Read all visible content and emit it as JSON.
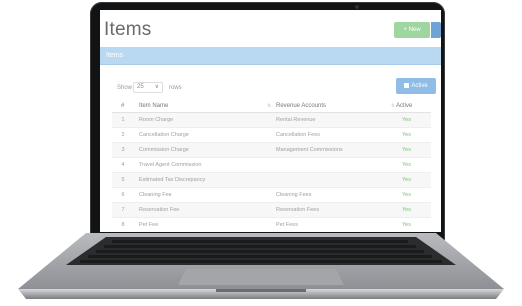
{
  "app": {
    "title": "Items",
    "new_button": "+ New",
    "panel_title": "Items"
  },
  "controls": {
    "show_label": "Show",
    "page_size": "25",
    "rows_label": "rows",
    "active_button": "Active"
  },
  "table": {
    "headers": {
      "num": "#",
      "name": "Item Name",
      "account": "Revenue Accounts",
      "active": "Active"
    },
    "rows": [
      {
        "num": "1",
        "name": "Room Charge",
        "account": "Rental Revenue",
        "active": "Yes"
      },
      {
        "num": "2",
        "name": "Cancellation Charge",
        "account": "Cancellation Fees",
        "active": "Yes"
      },
      {
        "num": "3",
        "name": "Commission Charge",
        "account": "Management Commissions",
        "active": "Yes"
      },
      {
        "num": "4",
        "name": "Travel Agent Commission",
        "account": "",
        "active": "Yes"
      },
      {
        "num": "5",
        "name": "Estimated Tax Discrepancy",
        "account": "",
        "active": "Yes"
      },
      {
        "num": "6",
        "name": "Cleaning Fee",
        "account": "Cleaning Fees",
        "active": "Yes"
      },
      {
        "num": "7",
        "name": "Reservation Fee",
        "account": "Reservation Fees",
        "active": "Yes"
      },
      {
        "num": "8",
        "name": "Pet Fee",
        "account": "Pet Fees",
        "active": "Yes"
      }
    ]
  },
  "colors": {
    "new_button": "#9fd69f",
    "panel_bar": "#b9d9f2",
    "active_button": "#8fbde6",
    "yes_text": "#7cc17c",
    "laptop_bezel": "#121314"
  }
}
